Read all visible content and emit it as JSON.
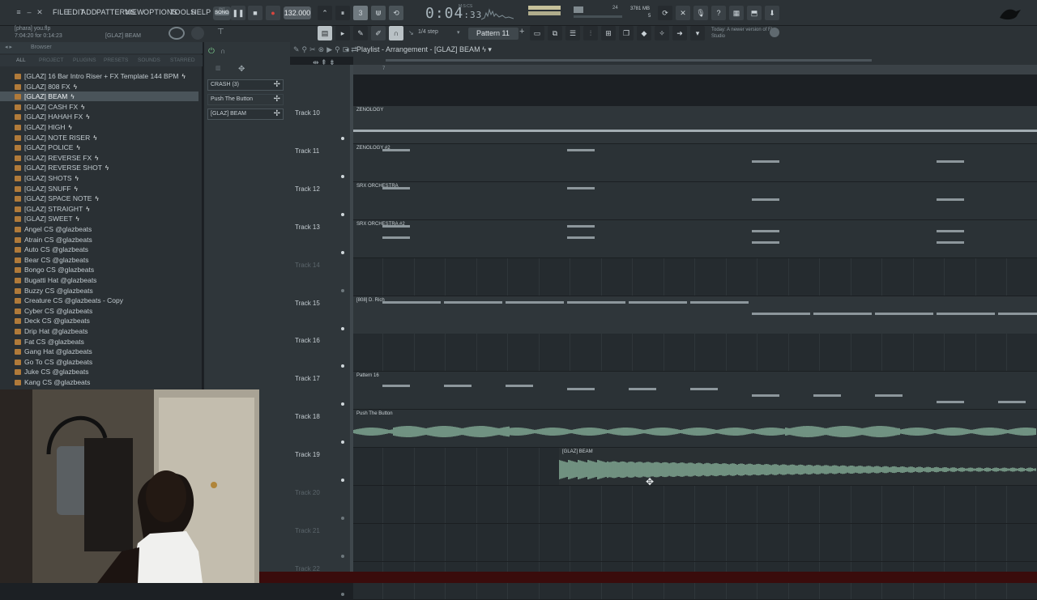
{
  "menu": [
    "FILE",
    "EDIT",
    "ADD",
    "PATTERNS",
    "VIEW",
    "OPTIONS",
    "TOOLS",
    "HELP"
  ],
  "transport": {
    "mode_label": "SONG",
    "mode_top": "PAT",
    "bpm": "132.000",
    "time": "0:04",
    "time_small": "33",
    "time_unit": "M:S:CS"
  },
  "cpu": {
    "memory": "3781 MB",
    "polyphony": "5",
    "cpu_value": "24"
  },
  "project": {
    "file": "[phara] you.flp",
    "time": "7:04:20 for 0:14:23",
    "hint_item": "[GLAZ] BEAM"
  },
  "toolbar2": {
    "step": "1/4 step",
    "pattern": "Pattern 11",
    "news": "Today: A newer version of FL Studio"
  },
  "browser": {
    "title": "Browser",
    "tabs": [
      "ALL",
      "PROJECT",
      "PLUGINS",
      "PRESETS",
      "SOUNDS",
      "STARRED"
    ],
    "items": [
      {
        "label": "[GLAZ] 16 Bar Intro Riser + FX Template 144 BPM",
        "bolt": "ϟ",
        "selected": false
      },
      {
        "label": "[GLAZ] 808 FX",
        "bolt": "ϟ",
        "selected": false
      },
      {
        "label": "[GLAZ] BEAM",
        "bolt": "ϟ",
        "selected": true
      },
      {
        "label": "[GLAZ] CASH FX",
        "bolt": "ϟ",
        "selected": false
      },
      {
        "label": "[GLAZ] HAHAH FX",
        "bolt": "ϟ",
        "selected": false
      },
      {
        "label": "[GLAZ] HIGH",
        "bolt": "ϟ",
        "selected": false
      },
      {
        "label": "[GLAZ] NOTE RISER",
        "bolt": "ϟ",
        "selected": false
      },
      {
        "label": "[GLAZ] POLICE",
        "bolt": "ϟ",
        "selected": false
      },
      {
        "label": "[GLAZ] REVERSE FX",
        "bolt": "ϟ",
        "selected": false
      },
      {
        "label": "[GLAZ] REVERSE SHOT",
        "bolt": "ϟ",
        "selected": false
      },
      {
        "label": "[GLAZ] SHOTS",
        "bolt": "ϟ",
        "selected": false
      },
      {
        "label": "[GLAZ] SNUFF",
        "bolt": "ϟ",
        "selected": false
      },
      {
        "label": "[GLAZ] SPACE NOTE",
        "bolt": "ϟ",
        "selected": false
      },
      {
        "label": "[GLAZ] STRAIGHT",
        "bolt": "ϟ",
        "selected": false
      },
      {
        "label": "[GLAZ] SWEET",
        "bolt": "ϟ",
        "selected": false
      },
      {
        "label": "Angel CS @glazbeats",
        "bolt": "",
        "selected": false
      },
      {
        "label": "Atrain CS @glazbeats",
        "bolt": "",
        "selected": false
      },
      {
        "label": "Auto CS @glazbeats",
        "bolt": "",
        "selected": false
      },
      {
        "label": "Bear CS @glazbeats",
        "bolt": "",
        "selected": false
      },
      {
        "label": "Bongo CS @glazbeats",
        "bolt": "",
        "selected": false
      },
      {
        "label": "Bugatti Hat @glazbeats",
        "bolt": "",
        "selected": false
      },
      {
        "label": "Buzzy CS @glazbeats",
        "bolt": "",
        "selected": false
      },
      {
        "label": "Creature CS @glazbeats - Copy",
        "bolt": "",
        "selected": false
      },
      {
        "label": "Cyber CS @glazbeats",
        "bolt": "",
        "selected": false
      },
      {
        "label": "Deck CS @glazbeats",
        "bolt": "",
        "selected": false
      },
      {
        "label": "Drip Hat @glazbeats",
        "bolt": "",
        "selected": false
      },
      {
        "label": "Fat CS @glazbeats",
        "bolt": "",
        "selected": false
      },
      {
        "label": "Gang Hat @glazbeats",
        "bolt": "",
        "selected": false
      },
      {
        "label": "Go To CS @glazbeats",
        "bolt": "",
        "selected": false
      },
      {
        "label": "Juke CS @glazbeats",
        "bolt": "",
        "selected": false
      },
      {
        "label": "Kang CS @glazbeats",
        "bolt": "",
        "selected": false
      }
    ]
  },
  "picker": {
    "items": [
      {
        "label": "CRASH (3)"
      },
      {
        "label": "Push The Button"
      },
      {
        "label": "[GLAZ] BEAM"
      }
    ]
  },
  "playlist": {
    "title": "Playlist - Arrangement",
    "crumb": "[GLAZ] BEAM",
    "ruler_mark": "7",
    "tracks": [
      {
        "name": "Track 10",
        "muted": false,
        "clip": "ZENOLOGY"
      },
      {
        "name": "Track 11",
        "muted": false,
        "clip": "ZENOLOGY #2"
      },
      {
        "name": "Track 12",
        "muted": false,
        "clip": "SRX ORCHESTRA"
      },
      {
        "name": "Track 13",
        "muted": false,
        "clip": "SRX ORCHESTRA #2"
      },
      {
        "name": "Track 14",
        "muted": true,
        "clip": ""
      },
      {
        "name": "Track 15",
        "muted": false,
        "clip": "[808] D. Rich"
      },
      {
        "name": "Track 16",
        "muted": false,
        "clip": ""
      },
      {
        "name": "Track 17",
        "muted": false,
        "clip": "Pattern 16"
      },
      {
        "name": "Track 18",
        "muted": false,
        "clip": "Push The Button"
      },
      {
        "name": "Track 19",
        "muted": false,
        "clip": "[GLAZ] BEAM"
      },
      {
        "name": "Track 20",
        "muted": true,
        "clip": ""
      },
      {
        "name": "Track 21",
        "muted": true,
        "clip": ""
      },
      {
        "name": "Track 22",
        "muted": true,
        "clip": ""
      }
    ]
  },
  "colors": {
    "accent_record": "#d9463f",
    "accent_green": "#79c68a",
    "wave_color": "#9fd1b4"
  }
}
